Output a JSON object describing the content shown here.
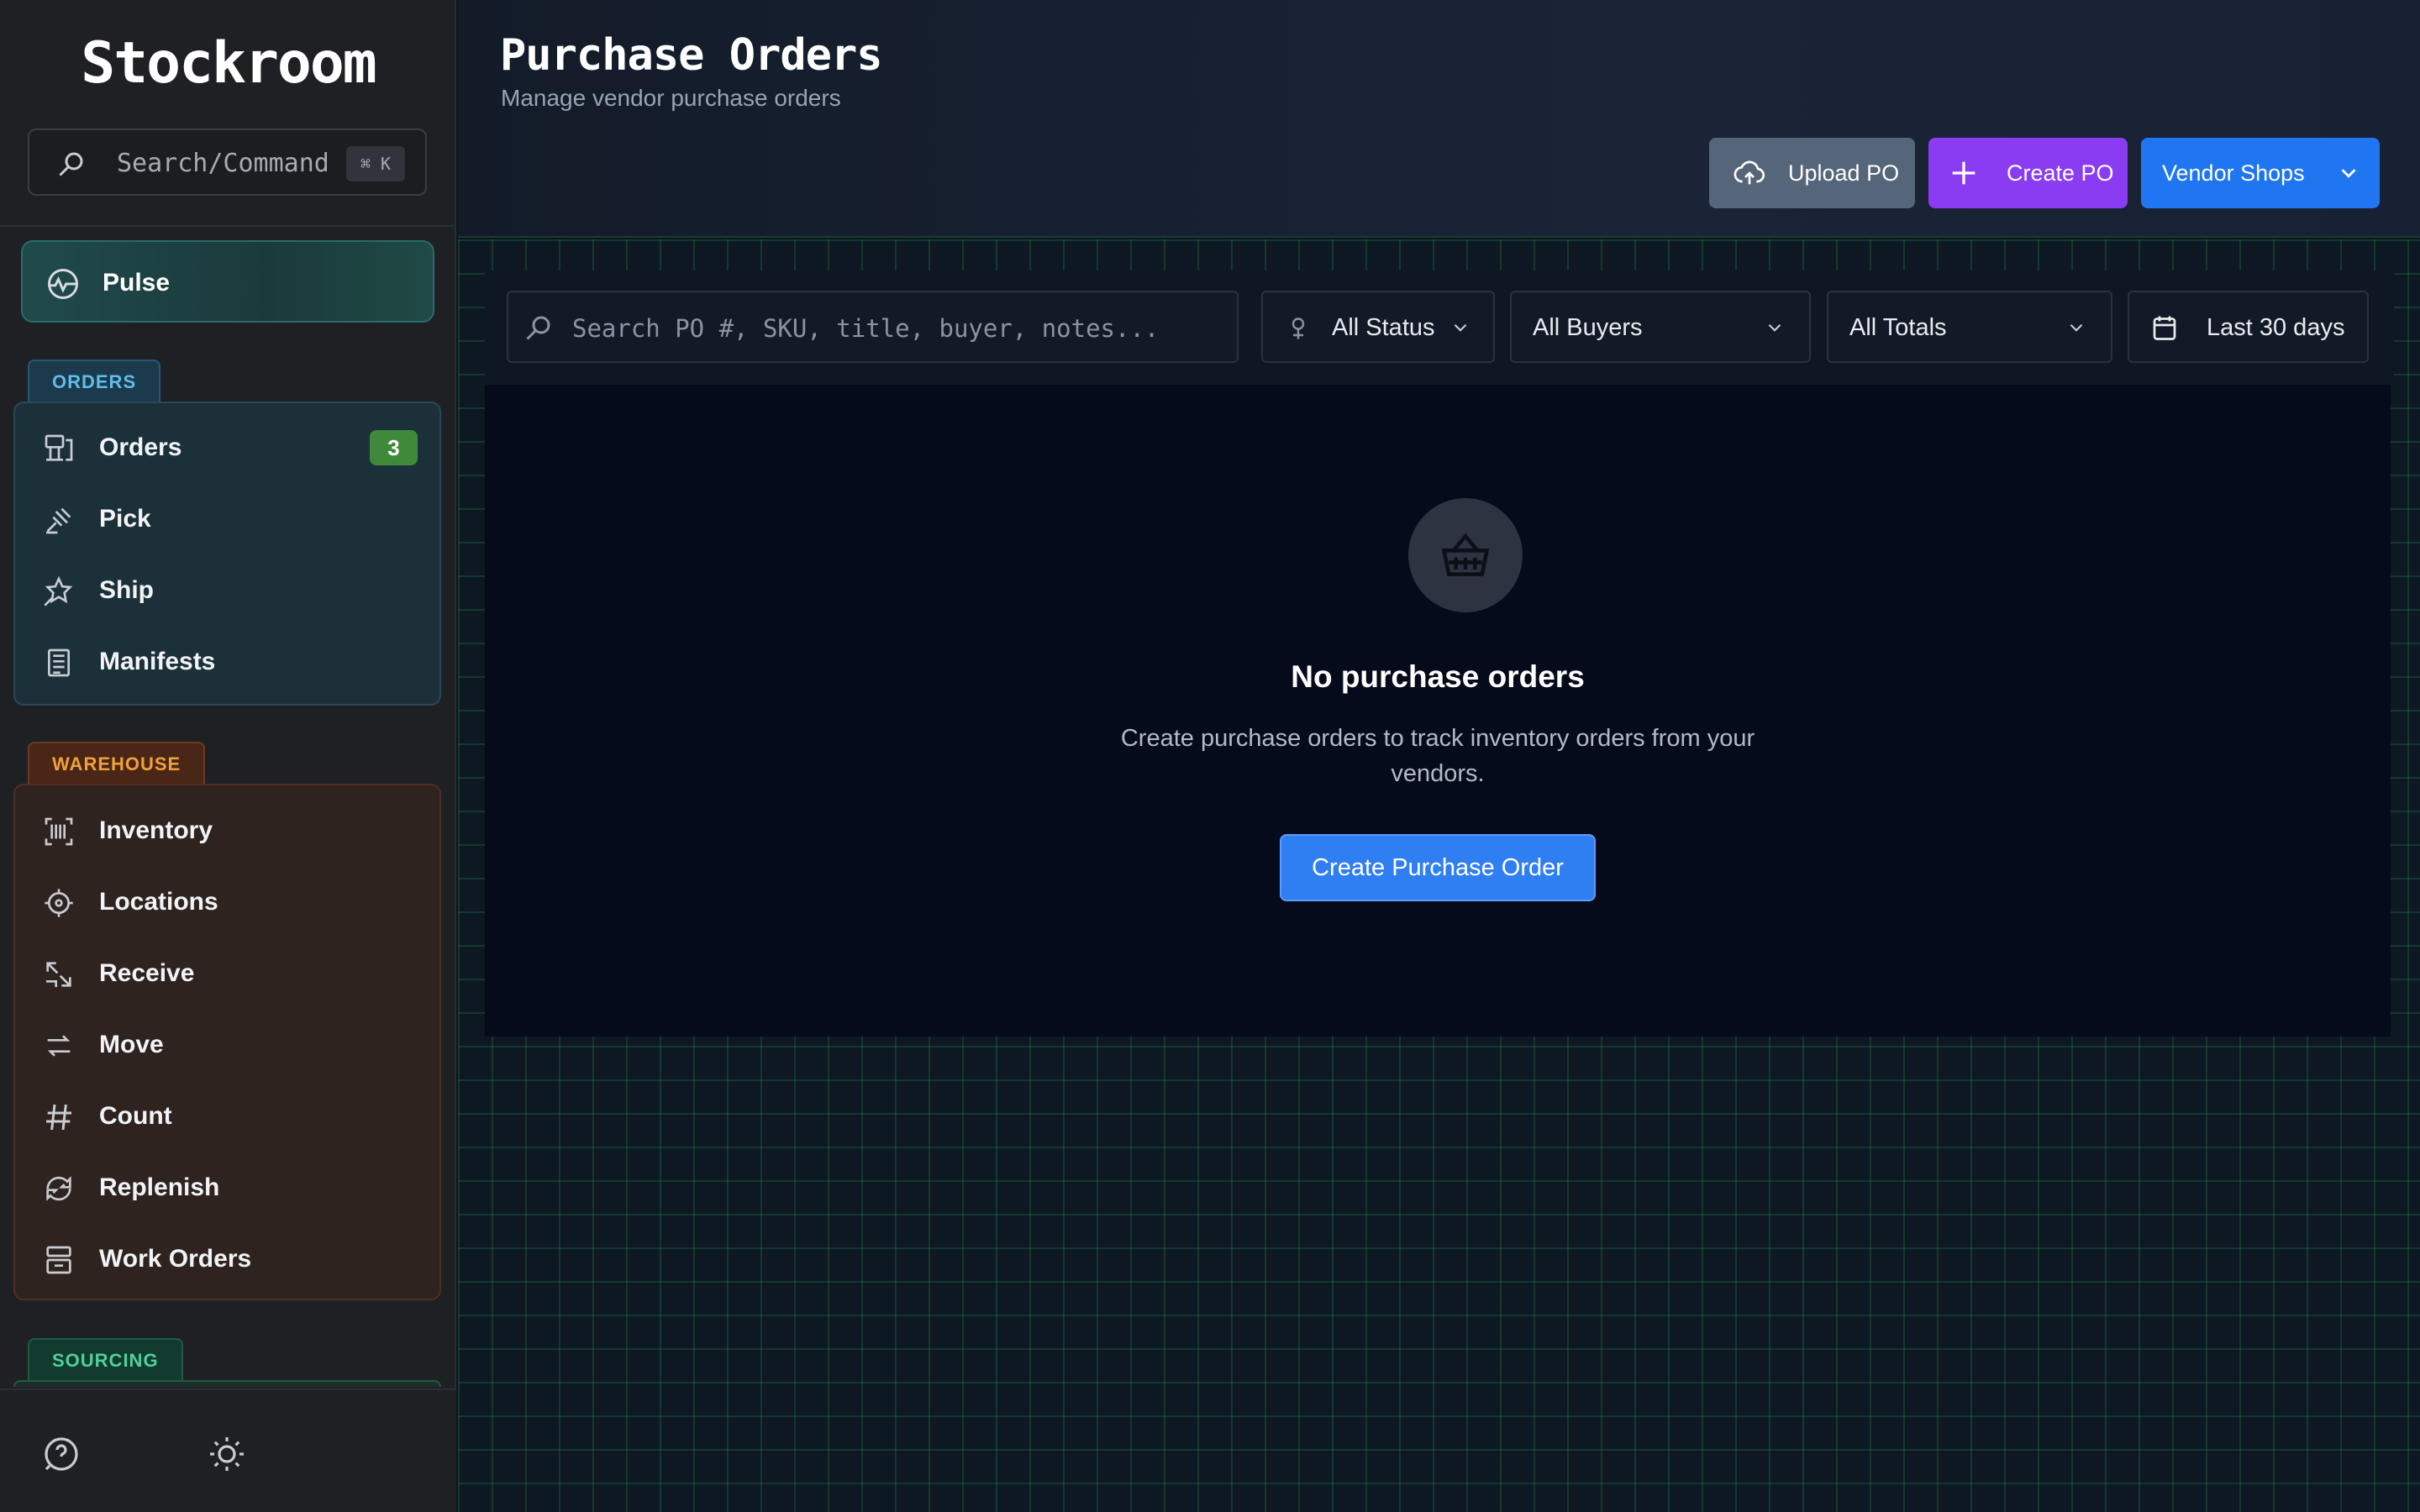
{
  "sidebar": {
    "brand": "Stockroom",
    "search": {
      "placeholder": "Search/Command",
      "shortcut": "⌘ K"
    },
    "pulse": {
      "label": "Pulse"
    },
    "sections": {
      "orders": {
        "title": "ORDERS",
        "items": [
          {
            "label": "Orders",
            "icon": "orders-icon",
            "badge": "3"
          },
          {
            "label": "Pick",
            "icon": "pick-icon"
          },
          {
            "label": "Ship",
            "icon": "ship-icon"
          },
          {
            "label": "Manifests",
            "icon": "manifests-icon"
          }
        ]
      },
      "warehouse": {
        "title": "WAREHOUSE",
        "items": [
          {
            "label": "Inventory",
            "icon": "barcode-icon"
          },
          {
            "label": "Locations",
            "icon": "crosshair-icon"
          },
          {
            "label": "Receive",
            "icon": "receive-icon"
          },
          {
            "label": "Move",
            "icon": "move-icon"
          },
          {
            "label": "Count",
            "icon": "hash-icon"
          },
          {
            "label": "Replenish",
            "icon": "replenish-icon"
          },
          {
            "label": "Work Orders",
            "icon": "work-orders-icon"
          }
        ]
      },
      "sourcing": {
        "title": "SOURCING"
      }
    },
    "footer": {
      "help_icon": "help-icon",
      "theme_icon": "sun-icon"
    }
  },
  "header": {
    "title": "Purchase Orders",
    "subtitle": "Manage vendor purchase orders",
    "buttons": {
      "upload": "Upload PO",
      "create": "Create PO",
      "vendor": "Vendor Shops"
    }
  },
  "filters": {
    "search_placeholder": "Search PO #, SKU, title, buyer, notes...",
    "status": "All Status",
    "buyers": "All Buyers",
    "totals": "All Totals",
    "date_range": "Last 30 days"
  },
  "empty_state": {
    "icon": "basket-icon",
    "title": "No purchase orders",
    "text": "Create purchase orders to track inventory orders from your vendors.",
    "button": "Create Purchase Order"
  },
  "colors": {
    "orders_accent": "#5fbde8",
    "warehouse_accent": "#f0a13c",
    "sourcing_accent": "#4ed19c",
    "badge": "#3f8a3a",
    "create_po": "#8a3cf2",
    "vendor_shops": "#1f76f0",
    "primary_button": "#2f7ff2"
  }
}
